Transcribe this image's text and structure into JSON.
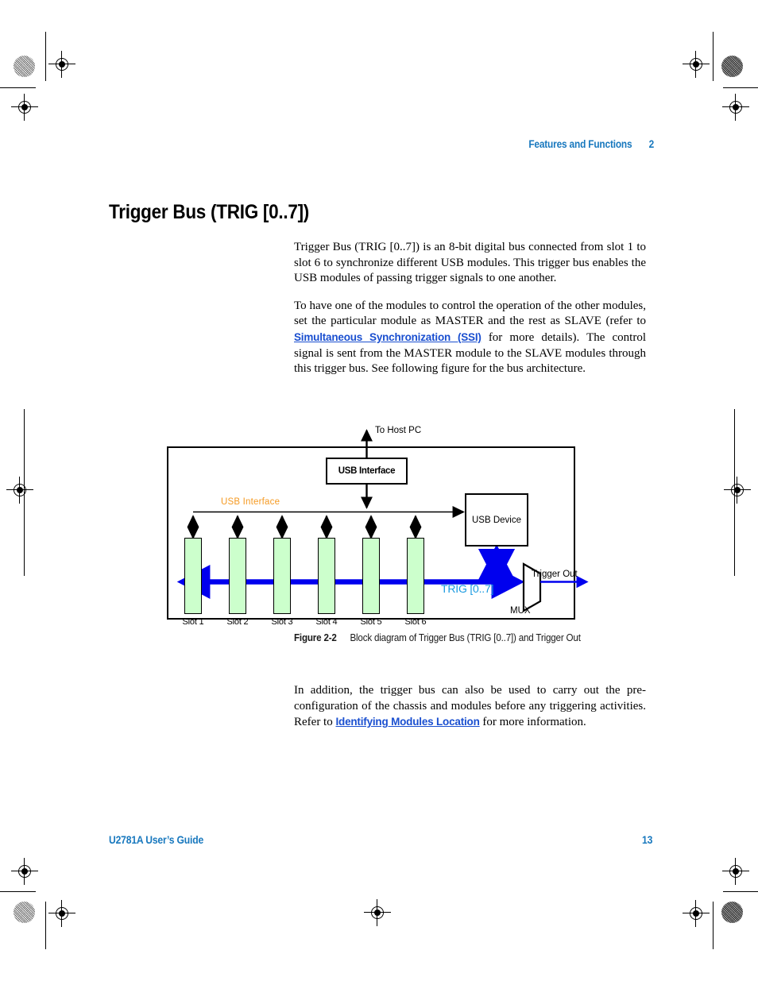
{
  "header": {
    "chapter_title": "Features and Functions",
    "chapter_number": "2"
  },
  "title": "Trigger Bus (TRIG [0..7])",
  "body": {
    "paragraph_1_part_1": "Trigger Bus (TRIG [0..7]) is an 8-bit digital bus connected from slot 1 to slot 6 to synchronize different USB modules. This trigger bus enables the USB modules of passing trigger signals to one another.",
    "paragraph_2_part_1": "To have one of the modules to control the operation of the other modules, set the particular module as MASTER and the rest as SLAVE (refer to ",
    "paragraph_2_link": "Simultaneous Synchronization (SSI)",
    "paragraph_2_part_2": " for more details). The control signal is sent from the MASTER module to the SLAVE modules through this trigger bus. See following figure for the bus architecture.",
    "paragraph_3_part_1": "In addition, the trigger bus can also be used to carry out the pre-configuration of the chassis and modules before any triggering activities. Refer to ",
    "paragraph_3_link": "Identifying Modules Location",
    "paragraph_3_part_2": " for more information."
  },
  "figure": {
    "caption_number": "Figure 2-2",
    "caption_text": "Block diagram of Trigger Bus (TRIG [0..7]) and Trigger Out",
    "host_label": "To Host PC",
    "usb_interface_box": "USB Interface",
    "usb_interface_bus_label": "USB Interface",
    "usb_device_box": "USB Device",
    "trig_bus_label": "TRIG [0..7]",
    "mux_label": "MUX",
    "trigger_out_label": "Trigger Out",
    "slots": [
      {
        "label": "Slot 1"
      },
      {
        "label": "Slot 2"
      },
      {
        "label": "Slot 3"
      },
      {
        "label": "Slot 4"
      },
      {
        "label": "Slot 5"
      },
      {
        "label": "Slot 6"
      }
    ],
    "colors": {
      "slot_fill": "#ccffcc",
      "trig_bus": "#0000ee",
      "trig_label": "#1a9ae0",
      "usb_interface_label": "#f59a22",
      "outline": "#000000"
    }
  },
  "footer": {
    "guide_title": "U2781A User’s Guide",
    "page_number": "13"
  }
}
